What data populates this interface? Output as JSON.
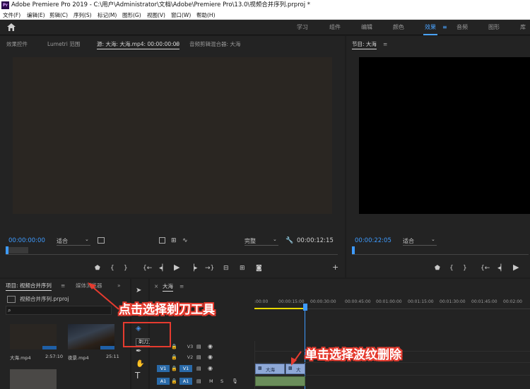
{
  "window": {
    "title": "Adobe Premiere Pro 2019 - C:\\用户\\Administrator\\文档\\Adobe\\Premiere Pro\\13.0\\视频合并序列.prproj *",
    "logo": "Pr"
  },
  "menu": [
    "文件(F)",
    "编辑(E)",
    "剪辑(C)",
    "序列(S)",
    "标记(M)",
    "图形(G)",
    "视图(V)",
    "窗口(W)",
    "帮助(H)"
  ],
  "workspaces": [
    {
      "label": "学习",
      "active": false
    },
    {
      "label": "组件",
      "active": false
    },
    {
      "label": "编辑",
      "active": false
    },
    {
      "label": "颜色",
      "active": false
    },
    {
      "label": "效果",
      "active": true
    },
    {
      "label": "音频",
      "active": false
    },
    {
      "label": "图形",
      "active": false
    },
    {
      "label": "库",
      "active": false
    }
  ],
  "workspace_menu_glyph": "≡",
  "source_panel": {
    "tabs": [
      "效果控件",
      "Lumetri 范围",
      "源: 大海: 大海.mp4: 00:00:00:00",
      "音频剪辑混合器: 大海"
    ],
    "menu_glyph": "≡",
    "timecode_in": "00:00:00:00",
    "fit": "适合",
    "quality": "完整",
    "timecode_out": "00:00:12:15"
  },
  "program_panel": {
    "tab": "节目: 大海",
    "menu_glyph": "≡",
    "timecode_in": "00:00:22:05",
    "fit": "适合"
  },
  "project_panel": {
    "tab": "项目: 视频合并序列",
    "menu_glyph": "≡",
    "tab2": "媒体浏览器",
    "more_glyph": "»",
    "file": "视频合并序列.prproj",
    "clips": [
      {
        "name": "大海.mp4",
        "duration": "2:57:10"
      },
      {
        "name": "夜景.mp4",
        "duration": "25:11"
      }
    ]
  },
  "tools": {
    "razor_tooltip": "剃刀工具 (C)",
    "type_glyph": "T"
  },
  "timeline": {
    "close_glyph": "×",
    "name": "大海",
    "menu_glyph": "≡",
    "current": "00:00:15:00",
    "ruler": [
      ":00:00",
      "00:00:15:00",
      "00:00:30:00",
      "00:00:45:00",
      "00:01:00:00",
      "00:01:15:00",
      "00:01:30:00",
      "00:01:45:00",
      "00:02:00"
    ],
    "tracks": [
      {
        "src": "",
        "name": "V3"
      },
      {
        "src": "",
        "name": "V2"
      },
      {
        "src": "V1",
        "name": "V1"
      },
      {
        "src": "A1",
        "name": "A1",
        "m": "M",
        "s": "S"
      }
    ],
    "clip_labels": [
      "大海",
      "大"
    ]
  },
  "annotations": {
    "razor": "点击选择剃刀工具",
    "ripple": "单击选择波纹删除"
  },
  "colors": {
    "accent": "#3e9bff",
    "annotation": "#e63b2f"
  }
}
